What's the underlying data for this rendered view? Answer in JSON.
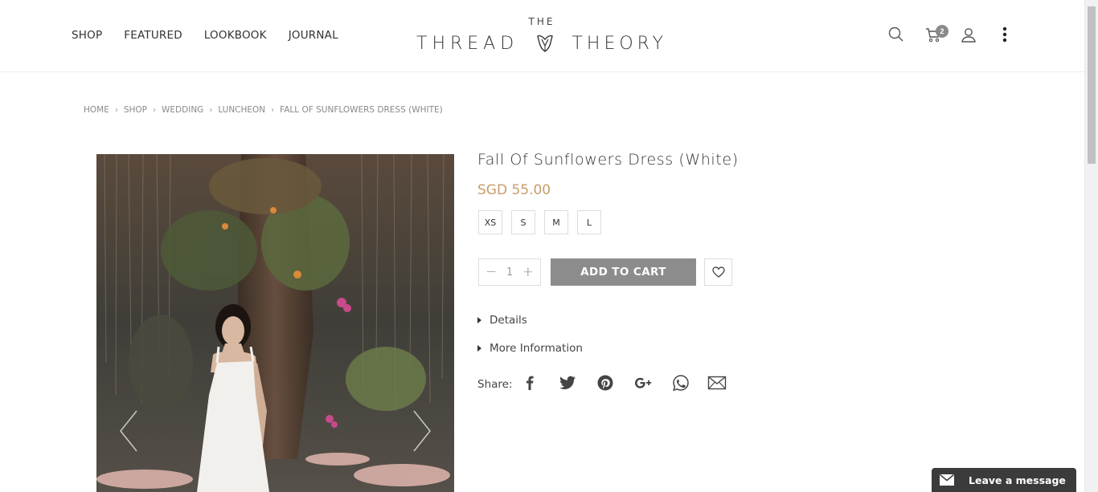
{
  "nav": {
    "items": [
      {
        "label": "SHOP"
      },
      {
        "label": "FEATURED"
      },
      {
        "label": "LOOKBOOK"
      },
      {
        "label": "JOURNAL"
      }
    ]
  },
  "logo": {
    "the": "THE",
    "word_left": "THREAD",
    "word_right": "THEORY"
  },
  "header_icons": {
    "search": "search-icon",
    "cart": "cart-icon",
    "account": "user-icon",
    "more": "more-vertical-icon",
    "cart_count": "2"
  },
  "breadcrumb": [
    {
      "label": "HOME"
    },
    {
      "label": "SHOP"
    },
    {
      "label": "WEDDING"
    },
    {
      "label": "LUNCHEON"
    },
    {
      "label": "FALL OF SUNFLOWERS DRESS (WHITE)"
    }
  ],
  "product": {
    "title": "Fall Of Sunflowers Dress (White)",
    "price": "SGD 55.00",
    "sizes": [
      "XS",
      "S",
      "M",
      "L"
    ],
    "quantity": "1",
    "add_to_cart": "ADD TO CART",
    "accordions": [
      "Details",
      "More Information"
    ],
    "share_label": "Share:",
    "share_icons": [
      "facebook-icon",
      "twitter-icon",
      "pinterest-icon",
      "google-plus-icon",
      "whatsapp-icon",
      "email-icon"
    ]
  },
  "colors": {
    "price": "#c79c6a",
    "button": "#8c8c8c",
    "chat": "#3b3b3b"
  },
  "chat": {
    "label": "Leave a message"
  }
}
